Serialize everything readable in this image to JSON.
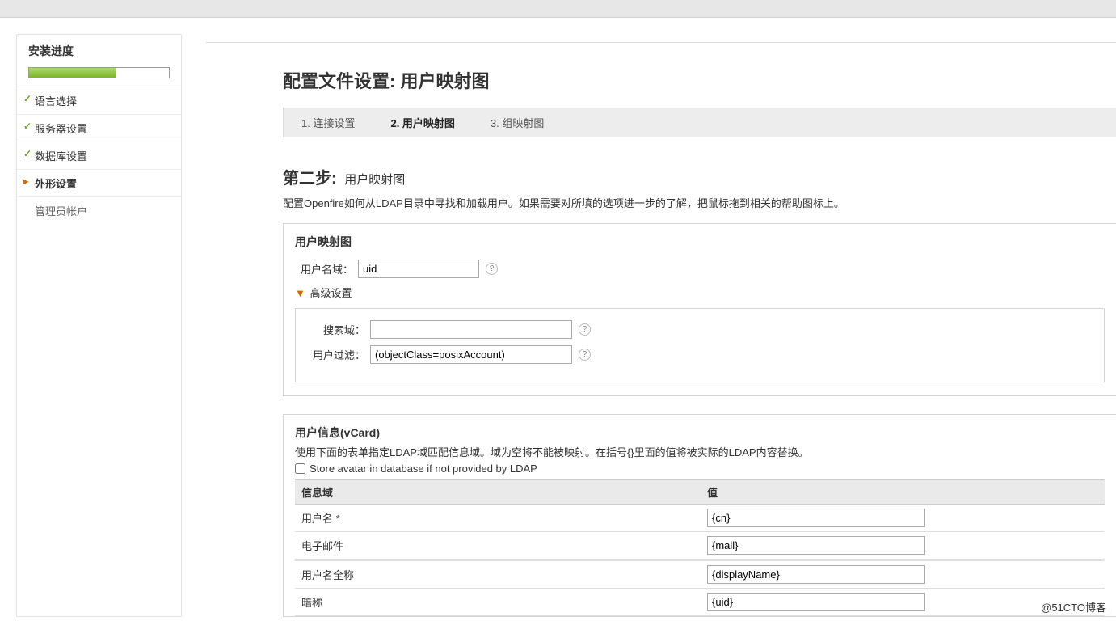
{
  "sidebar": {
    "title": "安装进度",
    "steps": [
      {
        "label": "语言选择",
        "state": "done"
      },
      {
        "label": "服务器设置",
        "state": "done"
      },
      {
        "label": "数据库设置",
        "state": "done"
      },
      {
        "label": "外形设置",
        "state": "current"
      },
      {
        "label": "管理员帐户",
        "state": "pending"
      }
    ]
  },
  "main": {
    "title": "配置文件设置: 用户映射图",
    "tabs": [
      {
        "label": "1. 连接设置"
      },
      {
        "label": "2. 用户映射图",
        "active": true
      },
      {
        "label": "3. 组映射图"
      }
    ],
    "step_heading": "第二步:",
    "step_sub": "用户映射图",
    "step_desc": "配置Openfire如何从LDAP目录中寻找和加载用户。如果需要对所填的选项进一步的了解，把鼠标拖到相关的帮助图标上。",
    "user_map": {
      "panel_title": "用户映射图",
      "username_field_label": "用户名域：",
      "username_field_value": "uid",
      "advanced_label": "高级设置",
      "search_fields_label": "搜索域：",
      "search_fields_value": "",
      "user_filter_label": "用户过滤：",
      "user_filter_value": "(objectClass=posixAccount)"
    },
    "vcard": {
      "panel_title": "用户信息(vCard)",
      "panel_desc": "使用下面的表单指定LDAP域匹配信息域。域为空将不能被映射。在括号{}里面的值将被实际的LDAP内容替换。",
      "store_avatar_label": "Store avatar in database if not provided by LDAP",
      "col_field": "信息域",
      "col_value": "值",
      "rows": [
        {
          "label": "用户名 *",
          "value": "{cn}"
        },
        {
          "label": "电子邮件",
          "value": "{mail}"
        },
        {
          "label": "用户名全称",
          "value": "{displayName}"
        },
        {
          "label": "暗称",
          "value": "{uid}"
        }
      ]
    }
  },
  "watermark": "@51CTO博客"
}
